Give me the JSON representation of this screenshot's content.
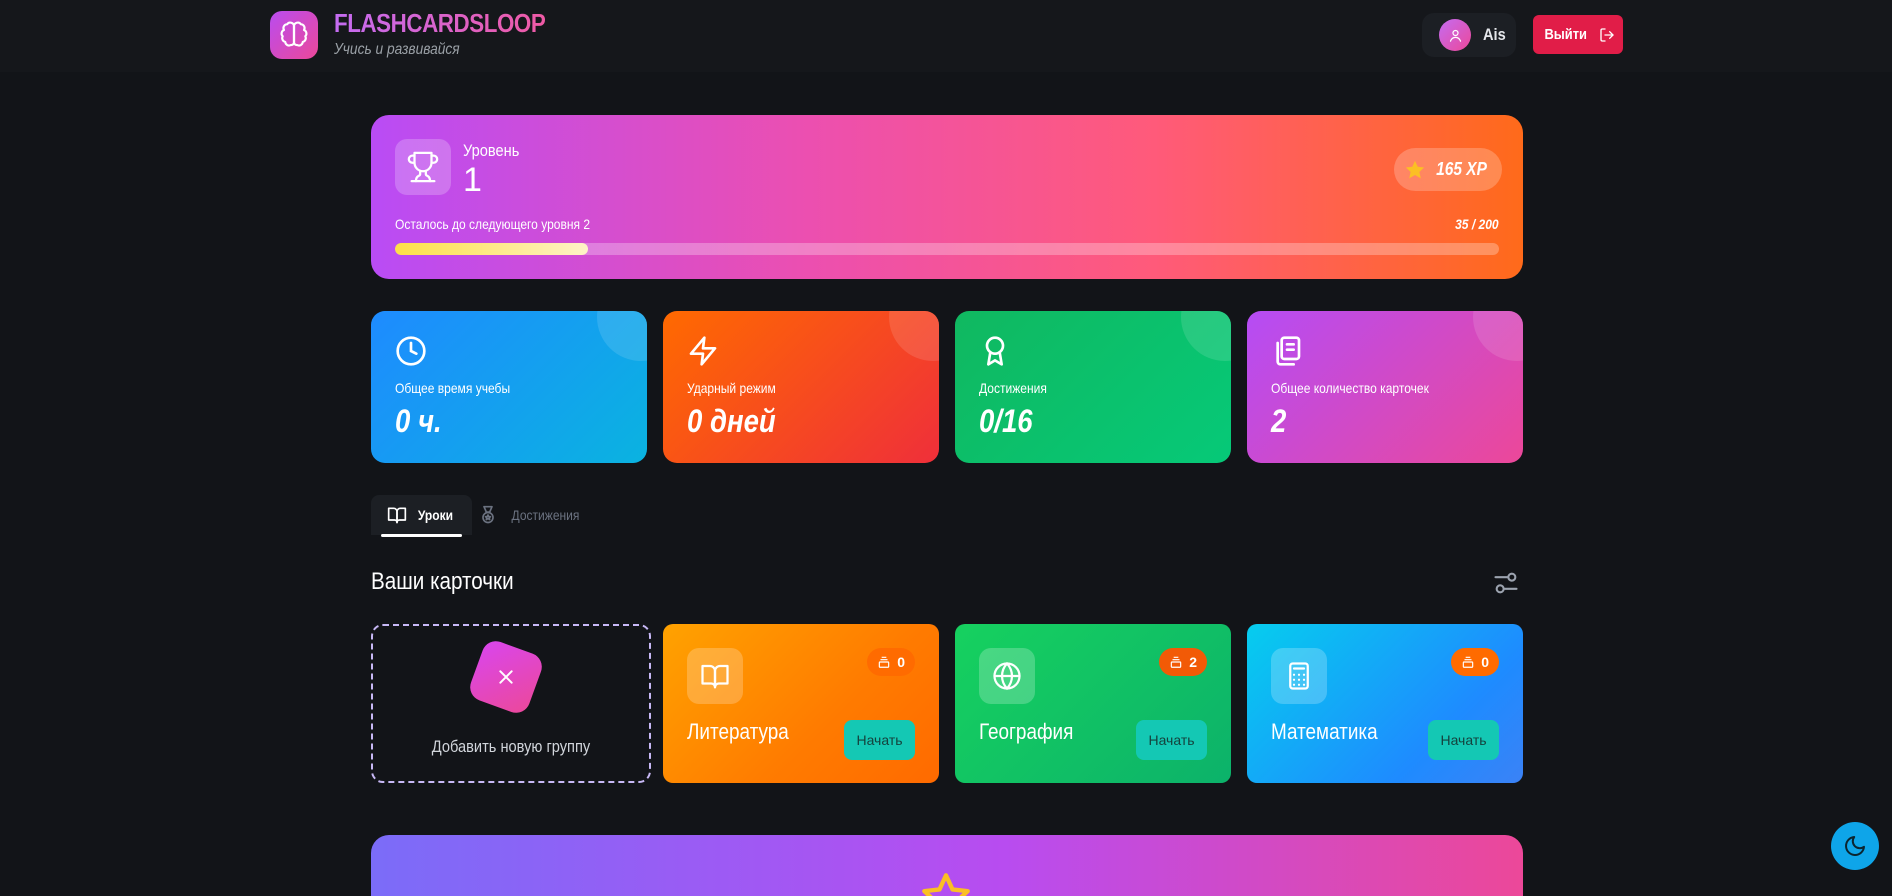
{
  "header": {
    "brand_title": "FLASHCARDSLOOP",
    "brand_subtitle": "Учись и развивайся",
    "user_name": "Ais",
    "logout_label": "Выйти"
  },
  "level": {
    "label": "Уровень",
    "value": "1",
    "xp": "165 XP",
    "progress_label": "Осталось до следующего уровня 2",
    "progress_count": "35 / 200",
    "progress_fraction": 0.175
  },
  "stats": [
    {
      "label": "Общее время учебы",
      "value": "0 ч.",
      "icon": "clock-icon"
    },
    {
      "label": "Ударный режим",
      "value": "0 дней",
      "icon": "lightning-icon"
    },
    {
      "label": "Достижения",
      "value": "0/16",
      "icon": "award-icon"
    },
    {
      "label": "Общее количество карточек",
      "value": "2",
      "icon": "cards-icon"
    }
  ],
  "tabs": [
    {
      "label": "Уроки",
      "active": true
    },
    {
      "label": "Достижения",
      "active": false
    }
  ],
  "section_title": "Ваши карточки",
  "add_group_label": "Добавить новую группу",
  "groups": [
    {
      "name": "Литература",
      "count": "0",
      "start_label": "Начать",
      "icon": "book-icon"
    },
    {
      "name": "География",
      "count": "2",
      "start_label": "Начать",
      "icon": "globe-icon"
    },
    {
      "name": "Математика",
      "count": "0",
      "start_label": "Начать",
      "icon": "calculator-icon"
    }
  ],
  "colors": {
    "background": "#121418",
    "accent_pink": "#ec4899",
    "accent_purple": "#b94cf5",
    "logout_red": "#e11d48",
    "start_teal": "#14c8b4"
  }
}
